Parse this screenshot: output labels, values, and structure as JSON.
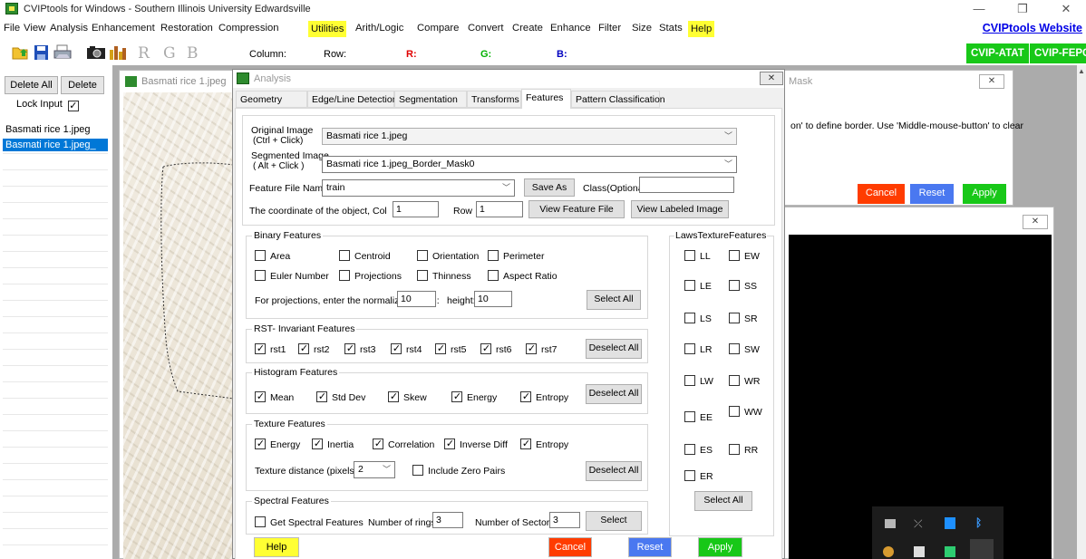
{
  "window": {
    "title": "CVIPtools for Windows - Southern Illinois University Edwardsville"
  },
  "menu": {
    "items": [
      "File",
      "View",
      "Analysis",
      "Enhancement",
      "Restoration",
      "Compression",
      "Utilities",
      "Arith/Logic",
      "Compare",
      "Convert",
      "Create",
      "Enhance",
      "Filter",
      "Size",
      "Stats",
      "Help"
    ],
    "website": "CVIPtools Website"
  },
  "toolbar": {
    "r": "R",
    "g": "G",
    "b": "B",
    "column_label": "Column:",
    "row_label": "Row:",
    "r_label": "R:",
    "g_label": "G:",
    "b_label": "B:",
    "atat": "CVIP-ATAT",
    "fepc": "CVIP-FEPC"
  },
  "left": {
    "delete_all": "Delete All",
    "delete": "Delete",
    "lock_input": "Lock Input",
    "files": [
      "Basmati rice 1.jpeg",
      "Basmati rice 1.jpeg_"
    ]
  },
  "image_window": {
    "title": "Basmati rice 1.jpeg"
  },
  "mask_window": {
    "title": "Mask",
    "hint_line1": "on' to define border. Use 'Middle-mouse-button' to clear",
    "cancel": "Cancel",
    "reset": "Reset",
    "apply": "Apply"
  },
  "dialog": {
    "title": "Analysis",
    "tabs": [
      "Geometry",
      "Edge/Line Detection",
      "Segmentation",
      "Transforms",
      "Features",
      "Pattern Classification"
    ],
    "original_image_label": "Original Image",
    "original_image_hint": "(Ctrl + Click)",
    "original_image_value": "Basmati rice 1.jpeg",
    "segmented_image_label": "Segmented Image",
    "segmented_image_hint": "( Alt + Click )",
    "segmented_image_value": "Basmati rice 1.jpeg_Border_Mask0",
    "feature_file_label": "Feature File Name",
    "feature_file_value": "train",
    "save_as": "Save As",
    "class_label": "Class(Optional)",
    "class_value": "",
    "coord_label": "The coordinate of the object, Col",
    "col_value": "1",
    "row_label": "Row",
    "row_value": "1",
    "view_feature_file": "View Feature File",
    "view_labeled_image": "View Labeled Image",
    "binary": {
      "title": "Binary Features",
      "items": [
        "Area",
        "Centroid",
        "Orientation",
        "Perimeter",
        "Euler Number",
        "Projections",
        "Thinness",
        "Aspect Ratio"
      ],
      "projection_label": "For projections, enter the normalizing width:",
      "width_value": "10",
      "height_label": "height:",
      "height_value": "10",
      "select_all": "Select All"
    },
    "rst": {
      "title": "RST- Invariant Features",
      "items": [
        "rst1",
        "rst2",
        "rst3",
        "rst4",
        "rst5",
        "rst6",
        "rst7"
      ],
      "deselect_all": "Deselect All"
    },
    "histogram": {
      "title": "Histogram Features",
      "items": [
        "Mean",
        "Std Dev",
        "Skew",
        "Energy",
        "Entropy"
      ],
      "deselect_all": "Deselect All"
    },
    "texture": {
      "title": "Texture Features",
      "items": [
        "Energy",
        "Inertia",
        "Correlation",
        "Inverse Diff",
        "Entropy"
      ],
      "distance_label": "Texture distance (pixels)",
      "distance_value": "2",
      "zero_pairs": "Include Zero Pairs",
      "deselect_all": "Deselect All"
    },
    "spectral": {
      "title": "Spectral Features",
      "get": "Get Spectral Features",
      "rings_label": "Number of rings",
      "rings_value": "3",
      "sectors_label": "Number of Sectors",
      "sectors_value": "3",
      "select": "Select"
    },
    "laws": {
      "title": "LawsTextureFeatures",
      "items": [
        "LL",
        "EW",
        "LE",
        "SS",
        "LS",
        "SR",
        "LR",
        "SW",
        "LW",
        "WR",
        "EE",
        "WW",
        "ES",
        "RR",
        "ER"
      ],
      "select_all": "Select All"
    },
    "help": "Help",
    "cancel": "Cancel",
    "reset": "Reset",
    "apply": "Apply"
  },
  "colors": {
    "help_yellow": "#ffff33",
    "cancel_red": "#ff3c00",
    "reset_blue": "#4a78f0",
    "apply_green": "#18c818",
    "selection_blue": "#0078d7"
  }
}
